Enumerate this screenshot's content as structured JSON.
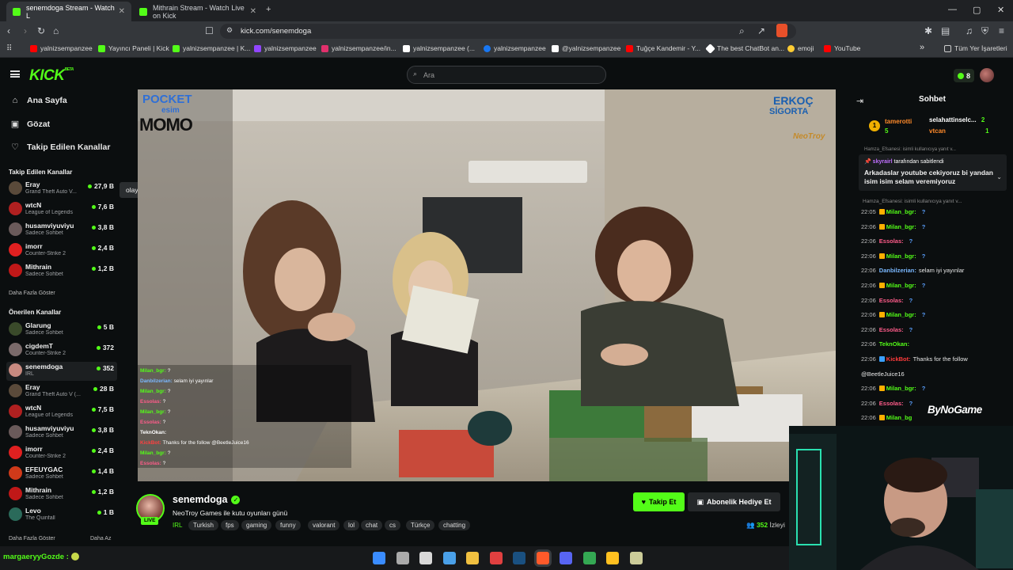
{
  "browser": {
    "tabs": [
      {
        "label": "senemdoga Stream - Watch L",
        "active": true
      },
      {
        "label": "Mithrain Stream - Watch Live on Kick",
        "active": false
      }
    ],
    "new_tab": "+",
    "url": "kick.com/senemdoga",
    "window_controls": [
      "—",
      "▢",
      "✕"
    ],
    "bookmarks": [
      {
        "label": "yalnizsempanzee",
        "color": "#ff0000"
      },
      {
        "label": "Yayıncı Paneli | Kick",
        "color": "#53fc18"
      },
      {
        "label": "yalnizsempanzee | K...",
        "color": "#53fc18"
      },
      {
        "label": "yalnizsempanzee",
        "color": "#9146ff"
      },
      {
        "label": "yalnizsempanzee/in...",
        "color": "#e1306c"
      },
      {
        "label": "yalnizsempanzee (...",
        "color": "#ffffff"
      },
      {
        "label": "yalnizsempanzee",
        "color": "#1877f2"
      },
      {
        "label": "@yalnizsempanzee",
        "color": "#ffffff"
      },
      {
        "label": "Tuğçe Kandemir - Y...",
        "color": "#ff0000"
      },
      {
        "label": "The best ChatBot an...",
        "color": "#ffffff"
      },
      {
        "label": "emoji",
        "color": "#ffcc33"
      },
      {
        "label": "YouTube",
        "color": "#ff0000"
      }
    ],
    "bookmarks_more": "»",
    "all_bookmarks": "Tüm Yer İşaretleri"
  },
  "kick": {
    "logo": "KICK",
    "logo_beta": "BETA",
    "search_placeholder": "Ara",
    "coins": "8"
  },
  "sidebar": {
    "nav": [
      {
        "label": "Ana Sayfa",
        "icon": "home-icon",
        "glyph": "⌂"
      },
      {
        "label": "Gözat",
        "icon": "browse-icon",
        "glyph": "▣"
      },
      {
        "label": "Takip Edilen Kanallar",
        "icon": "heart-icon",
        "glyph": "♡"
      }
    ],
    "followed_header": "Takip Edilen Kanallar",
    "followed": [
      {
        "name": "Eray",
        "category": "Grand Theft Auto V...",
        "viewers": "27,9 B",
        "color": "#5a4a3a"
      },
      {
        "name": "wtcN",
        "category": "League of Legends",
        "viewers": "7,6 B",
        "color": "#b02020"
      },
      {
        "name": "husamviyuviyu",
        "category": "Sadece Sohbet",
        "viewers": "3,8 B",
        "color": "#6a5a5a"
      },
      {
        "name": "imorr",
        "category": "Counter-Strike 2",
        "viewers": "2,4 B",
        "color": "#e02020"
      },
      {
        "name": "Mithrain",
        "category": "Sadece Sohbet",
        "viewers": "1,2 B",
        "color": "#c01818"
      }
    ],
    "followed_more": "Daha Fazla Göster",
    "recommended_header": "Önerilen Kanallar",
    "recommended": [
      {
        "name": "Glarung",
        "category": "Sadece Sohbet",
        "viewers": "5 B",
        "color": "#3a4a2a"
      },
      {
        "name": "cigdemT",
        "category": "Counter-Strike 2",
        "viewers": "372",
        "color": "#7a6a6a"
      },
      {
        "name": "senemdoga",
        "category": "IRL",
        "viewers": "352",
        "color": "#c88a80",
        "active": true
      },
      {
        "name": "Eray",
        "category": "Grand Theft Auto V (...",
        "viewers": "28 B",
        "color": "#5a4a3a"
      },
      {
        "name": "wtcN",
        "category": "League of Legends",
        "viewers": "7,5 B",
        "color": "#b02020"
      },
      {
        "name": "husamviyuviyu",
        "category": "Sadece Sohbet",
        "viewers": "3,8 B",
        "color": "#6a5a5a"
      },
      {
        "name": "imorr",
        "category": "Counter-Strike 2",
        "viewers": "2,4 B",
        "color": "#e02020"
      },
      {
        "name": "EFEUYGAC",
        "category": "Sadece Sohbet",
        "viewers": "1,4 B",
        "color": "#d03a1a"
      },
      {
        "name": "Mithrain",
        "category": "Sadece Sohbet",
        "viewers": "1,2 B",
        "color": "#c01818"
      },
      {
        "name": "Levo",
        "category": "The Quinfall",
        "viewers": "1 B",
        "color": "#2a6a5a"
      }
    ],
    "recommended_more": "Daha Fazla Göster",
    "recommended_less": "Daha Az",
    "tooltip": "olay yoğun !wraith"
  },
  "video": {
    "sponsor_left_1": "POCKET",
    "sponsor_left_2": "esim",
    "sponsor_left_3": "MOMO",
    "sponsor_right_1": "ERKOÇ",
    "sponsor_right_2": "SİGORTA",
    "sponsor_right_3": "NeoTroy",
    "overlay_chat": [
      {
        "user": "Milan_bgr:",
        "text": "?",
        "cls": "g"
      },
      {
        "user": "Danbilzerian:",
        "text": "selam iyi yayınlar",
        "cls": "b"
      },
      {
        "user": "Milan_bgr:",
        "text": "?",
        "cls": "g"
      },
      {
        "user": "Essolas:",
        "text": "?",
        "cls": "p"
      },
      {
        "user": "Milan_bgr:",
        "text": "?",
        "cls": "g"
      },
      {
        "user": "Essolas:",
        "text": "?",
        "cls": "p"
      },
      {
        "user": "TeknOkan:",
        "text": "",
        "cls": "w"
      },
      {
        "user": "KickBot:",
        "text": "Thanks for the follow @BeetleJuice16",
        "cls": "r"
      },
      {
        "user": "Milan_bgr:",
        "text": "?",
        "cls": "g"
      },
      {
        "user": "Essolas:",
        "text": "?",
        "cls": "p"
      }
    ]
  },
  "stream": {
    "name": "senemdoga",
    "live": "LIVE",
    "title": "NeoTroy Games ile kutu oyunları günü",
    "category": "IRL",
    "tags": [
      "Turkish",
      "fps",
      "gaming",
      "funny",
      "valorant",
      "lol",
      "chat",
      "cs",
      "Türkçe",
      "chatting"
    ],
    "follow_label": "Takip Et",
    "gift_label": "Abonelik Hediye Et",
    "viewers": "352",
    "viewers_label": "İzleyi"
  },
  "chat": {
    "title": "Sohbet",
    "gifters": [
      {
        "name": "tamerotti",
        "count": "5"
      },
      {
        "name": "selahattinselc...",
        "count": "2"
      },
      {
        "name": "vtcan",
        "count": "1"
      }
    ],
    "reply_preview": "Hamza_Efsanesi: isimli kullanıcıya yanıt v...",
    "pinned_by_user": "skyrairl",
    "pinned_by_text": "tarafından sabitlendi",
    "pinned_message": "Arkadaslar youtube cekiyoruz bi yandan isim isim selam veremiyoruz",
    "reply_preview_2": "Hamza_Efsanesi: isimli kullanıcıya yanıt v...",
    "messages": [
      {
        "time": "22:05",
        "user": "Milan_bgr:",
        "text": "?",
        "cls": "g",
        "badge": "#ffb000"
      },
      {
        "time": "22:06",
        "user": "Milan_bgr:",
        "text": "?",
        "cls": "g",
        "badge": "#ffb000"
      },
      {
        "time": "22:06",
        "user": "Essolas:",
        "text": "?",
        "cls": "p",
        "badge": ""
      },
      {
        "time": "22:06",
        "user": "Milan_bgr:",
        "text": "?",
        "cls": "g",
        "badge": "#ffb000"
      },
      {
        "time": "22:06",
        "user": "Danbilzerian:",
        "text": "selam iyi yayınlar",
        "cls": "b",
        "badge": ""
      },
      {
        "time": "22:06",
        "user": "Milan_bgr:",
        "text": "?",
        "cls": "g",
        "badge": "#ffb000"
      },
      {
        "time": "22:06",
        "user": "Essolas:",
        "text": "?",
        "cls": "p",
        "badge": ""
      },
      {
        "time": "22:06",
        "user": "Milan_bgr:",
        "text": "?",
        "cls": "g",
        "badge": "#ffb000"
      },
      {
        "time": "22:06",
        "user": "Essolas:",
        "text": "?",
        "cls": "p",
        "badge": ""
      },
      {
        "time": "22:06",
        "user": "TeknOkan:",
        "text": "",
        "cls": "g",
        "badge": ""
      },
      {
        "time": "22:06",
        "user": "KickBot:",
        "text": "Thanks for the follow",
        "cls": "r",
        "badge": "#3aa0ff"
      },
      {
        "time": "",
        "user": "",
        "text": "@BeetleJuice16",
        "cls": "w",
        "badge": ""
      },
      {
        "time": "22:06",
        "user": "Milan_bgr:",
        "text": "?",
        "cls": "g",
        "badge": "#ffb000"
      },
      {
        "time": "22:06",
        "user": "Essolas:",
        "text": "?",
        "cls": "p",
        "badge": ""
      },
      {
        "time": "22:06",
        "user": "Milan_bg",
        "text": "",
        "cls": "g",
        "badge": "#ffb000"
      }
    ]
  },
  "webcam": {
    "brand": "ByNoGame"
  },
  "taskbar": {
    "chat_user": "margaeryyGozde :",
    "icons": [
      "windows-icon",
      "taskview-icon",
      "notes-icon",
      "photos-icon",
      "folder-icon",
      "obs-icon",
      "steam-icon",
      "brave-icon",
      "discord-icon",
      "chrome-icon",
      "editor-icon",
      "media-icon"
    ]
  }
}
